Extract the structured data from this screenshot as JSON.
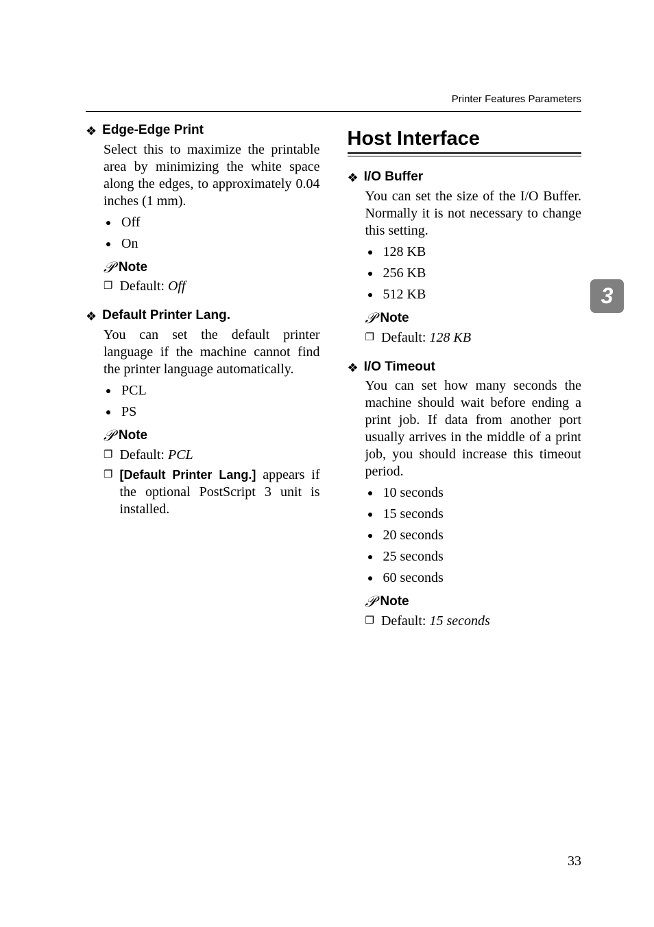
{
  "header": {
    "running": "Printer Features Parameters"
  },
  "side_tab": "3",
  "page_number": "33",
  "left": {
    "items": [
      {
        "title": "Edge-Edge Print",
        "para": "Select this to maximize the printable area by minimizing the white space along the edges, to approximately 0.04 inches (1 mm).",
        "bullets": [
          "Off",
          "On"
        ],
        "note_label": "Note",
        "checks": [
          {
            "pre": "Default: ",
            "em": "Off",
            "post": ""
          }
        ]
      },
      {
        "title": "Default Printer Lang.",
        "para": "You can set the default printer language if the machine cannot find the printer language automatically.",
        "bullets": [
          "PCL",
          "PS"
        ],
        "note_label": "Note",
        "checks": [
          {
            "pre": "Default: ",
            "em": "PCL",
            "post": ""
          },
          {
            "bold": "[Default Printer Lang.]",
            "post": " appears if the optional PostScript 3 unit is installed."
          }
        ]
      }
    ]
  },
  "right": {
    "heading": "Host Interface",
    "items": [
      {
        "title": "I/O Buffer",
        "para": "You can set the size of the I/O Buffer. Normally it is not necessary to change this setting.",
        "bullets": [
          "128 KB",
          "256 KB",
          "512 KB"
        ],
        "note_label": "Note",
        "checks": [
          {
            "pre": "Default: ",
            "em": "128 KB",
            "post": ""
          }
        ]
      },
      {
        "title": "I/O Timeout",
        "para": "You can set how many seconds the machine should wait before ending a print job. If data from another port usually arrives in the middle of a print job, you should increase this timeout period.",
        "bullets": [
          "10 seconds",
          "15 seconds",
          "20 seconds",
          "25 seconds",
          "60 seconds"
        ],
        "note_label": "Note",
        "checks": [
          {
            "pre": "Default: ",
            "em": "15 seconds",
            "post": ""
          }
        ]
      }
    ]
  }
}
